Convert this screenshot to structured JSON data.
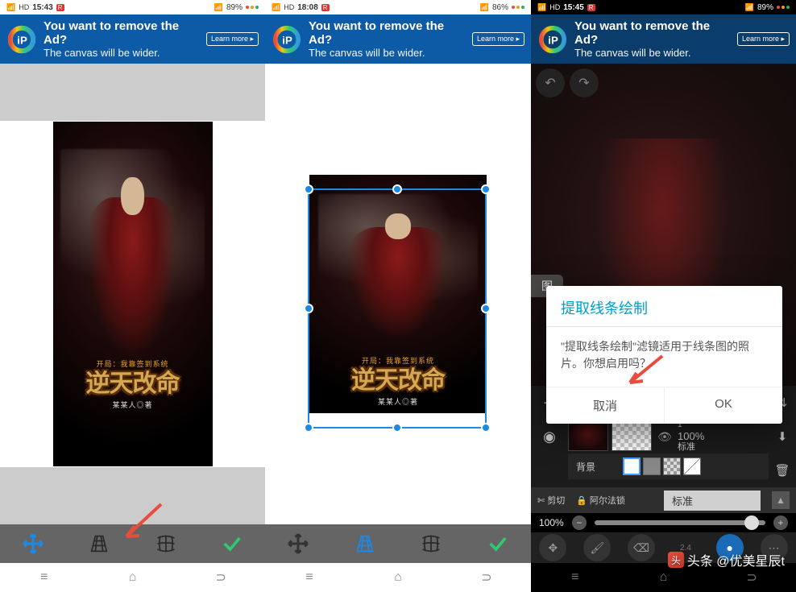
{
  "status": {
    "s1": {
      "time": "15:43",
      "battery": "89%",
      "signal": "5G"
    },
    "s2": {
      "time": "18:08",
      "battery": "86%",
      "signal": "5G"
    },
    "s3": {
      "time": "15:45",
      "battery": "89%",
      "signal": "5G"
    }
  },
  "ad": {
    "title": "You want to remove the Ad?",
    "subtitle": "The canvas will be wider.",
    "cta": "Learn more ▸"
  },
  "cover": {
    "line1": "开局：我靠签到系统",
    "title": "逆天改命",
    "author": "某某人◎著"
  },
  "dialog": {
    "title": "提取线条绘制",
    "body": "\"提取线条绘制\"滤镜适用于线条图的照片。你想启用吗？",
    "cancel": "取消",
    "ok": "OK"
  },
  "panel": {
    "header": "图",
    "layers": [
      {
        "name": "",
        "opacity": "100%",
        "blend": "标准",
        "selected": true
      },
      {
        "name": "1",
        "opacity": "100%",
        "blend": "标准",
        "selected": false
      }
    ],
    "bgLabel": "背景",
    "blendDropdown": "标准"
  },
  "bottomBar": {
    "clip": "剪切",
    "alpha": "阿尔法锁"
  },
  "slider": {
    "value": "100%"
  },
  "dock": {
    "brushSize": "2.4"
  },
  "watermark": "头条 @优美星辰t"
}
